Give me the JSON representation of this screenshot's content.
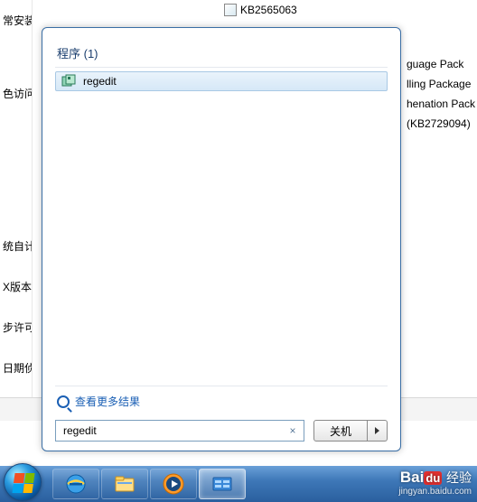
{
  "bg": {
    "kb_item": "KB2565063",
    "tree": [
      "常安装",
      "色访问",
      "统自计",
      "X版本",
      "步许可",
      "日期侦"
    ],
    "right_lines": [
      "guage Pack",
      "lling Package",
      "henation Pack",
      "(KB2729094)"
    ]
  },
  "start_menu": {
    "section_label": "程序 (1)",
    "result_label": "regedit",
    "see_more_label": "查看更多结果",
    "search_value": "regedit",
    "clear_symbol": "×",
    "shutdown_label": "关机"
  },
  "watermark": {
    "brand": "Bai",
    "brand2": "经验",
    "url": "jingyan.baidu.com"
  }
}
